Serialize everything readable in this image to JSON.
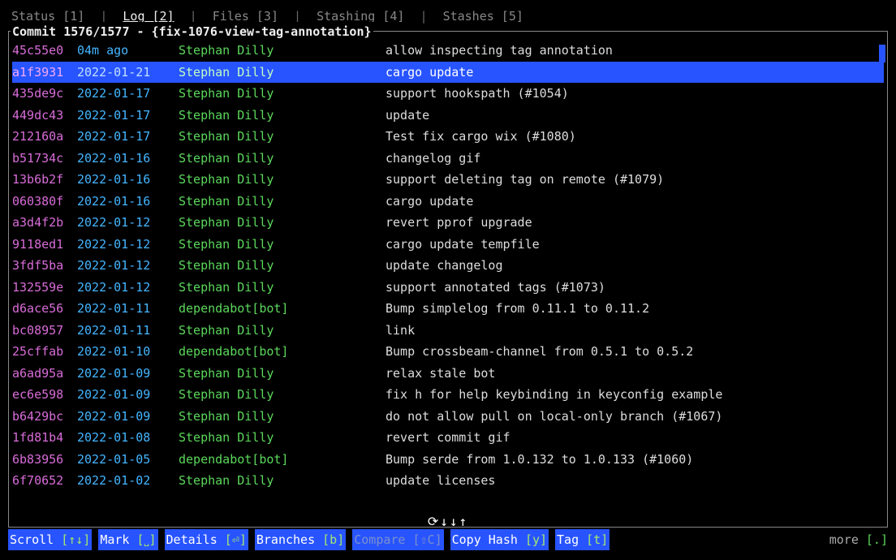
{
  "tabs": {
    "status": "Status [1]",
    "log": "Log [2]",
    "files": "Files [3]",
    "stashing": "Stashing [4]",
    "stashes": "Stashes [5]",
    "active_index": 1
  },
  "panel": {
    "title_prefix": "Commit ",
    "counter": "1576/1577",
    "separator": " - ",
    "branch": "{fix-1076-view-tag-annotation}"
  },
  "commits": [
    {
      "hash": "45c55e0",
      "date": "04m ago",
      "author": "Stephan Dilly",
      "msg": "allow inspecting tag annotation"
    },
    {
      "hash": "a1f3931",
      "date": "2022-01-21",
      "author": "Stephan Dilly",
      "msg": "cargo update"
    },
    {
      "hash": "435de9c",
      "date": "2022-01-17",
      "author": "Stephan Dilly",
      "msg": "support hookspath (#1054)"
    },
    {
      "hash": "449dc43",
      "date": "2022-01-17",
      "author": "Stephan Dilly",
      "msg": "update"
    },
    {
      "hash": "212160a",
      "date": "2022-01-17",
      "author": "Stephan Dilly",
      "msg": "Test fix cargo wix (#1080)"
    },
    {
      "hash": "b51734c",
      "date": "2022-01-16",
      "author": "Stephan Dilly",
      "msg": "changelog gif"
    },
    {
      "hash": "13b6b2f",
      "date": "2022-01-16",
      "author": "Stephan Dilly",
      "msg": "support deleting tag on remote (#1079)"
    },
    {
      "hash": "060380f",
      "date": "2022-01-16",
      "author": "Stephan Dilly",
      "msg": "cargo update"
    },
    {
      "hash": "a3d4f2b",
      "date": "2022-01-12",
      "author": "Stephan Dilly",
      "msg": "revert pprof upgrade"
    },
    {
      "hash": "9118ed1",
      "date": "2022-01-12",
      "author": "Stephan Dilly",
      "msg": "cargo update tempfile"
    },
    {
      "hash": "3fdf5ba",
      "date": "2022-01-12",
      "author": "Stephan Dilly",
      "msg": "update changelog"
    },
    {
      "hash": "132559e",
      "date": "2022-01-12",
      "author": "Stephan Dilly",
      "msg": "support annotated tags (#1073)"
    },
    {
      "hash": "d6ace56",
      "date": "2022-01-11",
      "author": "dependabot[bot]",
      "msg": "Bump simplelog from 0.11.1 to 0.11.2"
    },
    {
      "hash": "bc08957",
      "date": "2022-01-11",
      "author": "Stephan Dilly",
      "msg": "link"
    },
    {
      "hash": "25cffab",
      "date": "2022-01-10",
      "author": "dependabot[bot]",
      "msg": "Bump crossbeam-channel from 0.5.1 to 0.5.2"
    },
    {
      "hash": "a6ad95a",
      "date": "2022-01-09",
      "author": "Stephan Dilly",
      "msg": "relax stale bot"
    },
    {
      "hash": "ec6e598",
      "date": "2022-01-09",
      "author": "Stephan Dilly",
      "msg": "fix h for help keybinding in keyconfig example"
    },
    {
      "hash": "b6429bc",
      "date": "2022-01-09",
      "author": "Stephan Dilly",
      "msg": "do not allow pull on local-only branch (#1067)"
    },
    {
      "hash": "1fd81b4",
      "date": "2022-01-08",
      "author": "Stephan Dilly",
      "msg": "revert commit gif"
    },
    {
      "hash": "6b83956",
      "date": "2022-01-05",
      "author": "dependabot[bot]",
      "msg": "Bump serde from 1.0.132 to 1.0.133 (#1060)"
    },
    {
      "hash": "6f70652",
      "date": "2022-01-02",
      "author": "Stephan Dilly",
      "msg": "update licenses"
    }
  ],
  "selected_index": 1,
  "spinner": "⟳↓↓↑",
  "actions": {
    "scroll": {
      "label": "Scroll",
      "key": "[↑↓]"
    },
    "mark": {
      "label": "Mark",
      "key": "[˽]"
    },
    "details": {
      "label": "Details",
      "key": "[⏎]"
    },
    "branches": {
      "label": "Branches",
      "key": "[b]"
    },
    "compare": {
      "label": "Compare",
      "key": "[⇧C]"
    },
    "copyhash": {
      "label": "Copy Hash",
      "key": "[y]"
    },
    "tag": {
      "label": "Tag",
      "key": "[t]"
    },
    "more": {
      "label": "more",
      "key": "[.]"
    }
  }
}
